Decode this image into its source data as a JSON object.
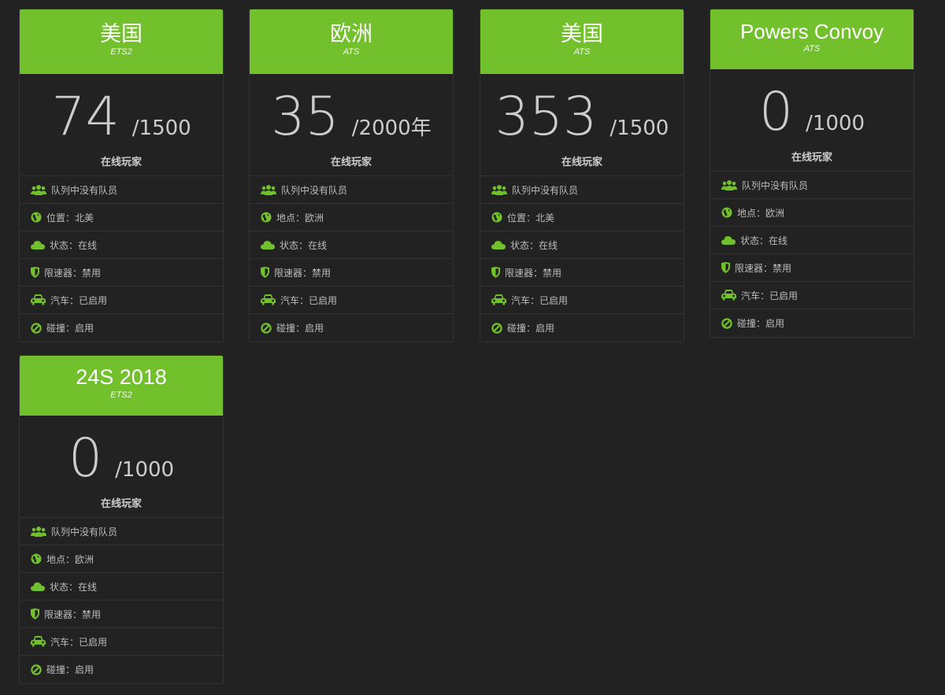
{
  "accent_color": "#72c02c",
  "servers": [
    {
      "name": "美国",
      "game": "ETS2",
      "players": "74",
      "max": "/1500",
      "players_label": "在线玩家",
      "queue": "队列中没有队员",
      "location": "位置：北美",
      "status": "状态：在线",
      "limiter": "限速器：禁用",
      "cars": "汽车：已启用",
      "collisions": "碰撞：启用"
    },
    {
      "name": "欧洲",
      "game": "ATS",
      "players": "35",
      "max": "/2000年",
      "players_label": "在线玩家",
      "queue": "队列中没有队员",
      "location": "地点：欧洲",
      "status": "状态：在线",
      "limiter": "限速器：禁用",
      "cars": "汽车：已启用",
      "collisions": "碰撞：启用"
    },
    {
      "name": "美国",
      "game": "ATS",
      "players": "353",
      "max": "/1500",
      "players_label": "在线玩家",
      "queue": "队列中没有队员",
      "location": "位置：北美",
      "status": "状态：在线",
      "limiter": "限速器：禁用",
      "cars": "汽车：已启用",
      "collisions": "碰撞：启用"
    },
    {
      "name": "Powers Convoy",
      "game": "ATS",
      "players": "0",
      "max": "/1000",
      "players_label": "在线玩家",
      "queue": "队列中没有队员",
      "location": "地点：欧洲",
      "status": "状态：在线",
      "limiter": "限速器：禁用",
      "cars": "汽车：已启用",
      "collisions": "碰撞：启用"
    },
    {
      "name": "24S 2018",
      "game": "ETS2",
      "players": "0",
      "max": "/1000",
      "players_label": "在线玩家",
      "queue": "队列中没有队员",
      "location": "地点：欧洲",
      "status": "状态：在线",
      "limiter": "限速器：禁用",
      "cars": "汽车：已启用",
      "collisions": "碰撞：启用"
    }
  ]
}
